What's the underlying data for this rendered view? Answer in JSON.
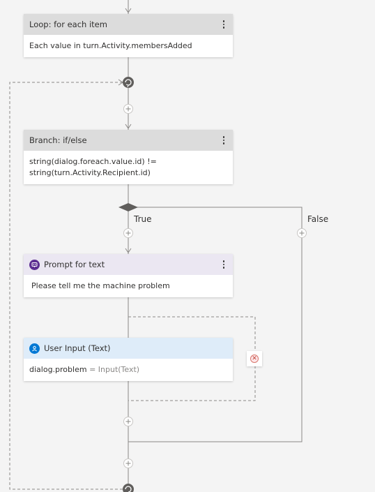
{
  "nodes": {
    "loop": {
      "title": "Loop: for each item",
      "body": "Each value in turn.Activity.membersAdded"
    },
    "branch": {
      "title": "Branch: if/else",
      "condition_line1": "string(dialog.foreach.value.id) !=",
      "condition_line2": "string(turn.Activity.Recipient.id)"
    },
    "prompt": {
      "title": "Prompt for text",
      "body": "Please tell me the machine problem",
      "icon": "chat-bot-icon"
    },
    "user_input": {
      "title": "User Input (Text)",
      "property": "dialog.problem",
      "operator": "=",
      "value": "Input(Text)",
      "icon": "person-icon"
    }
  },
  "branch_labels": {
    "true_label": "True",
    "false_label": "False"
  },
  "colors": {
    "header_gray": "#dcdcdc",
    "header_lavender": "#ebe7f2",
    "header_blue": "#deecf9",
    "line": "#8a8886",
    "prompt_icon": "#5c2e91",
    "user_icon": "#0078d4",
    "error": "#d9766c"
  },
  "icons": {
    "more": "more-vertical-icon",
    "add": "plus-icon",
    "loop_marker": "loop-icon",
    "error": "error-circle-icon",
    "branch": "diamond-icon"
  }
}
